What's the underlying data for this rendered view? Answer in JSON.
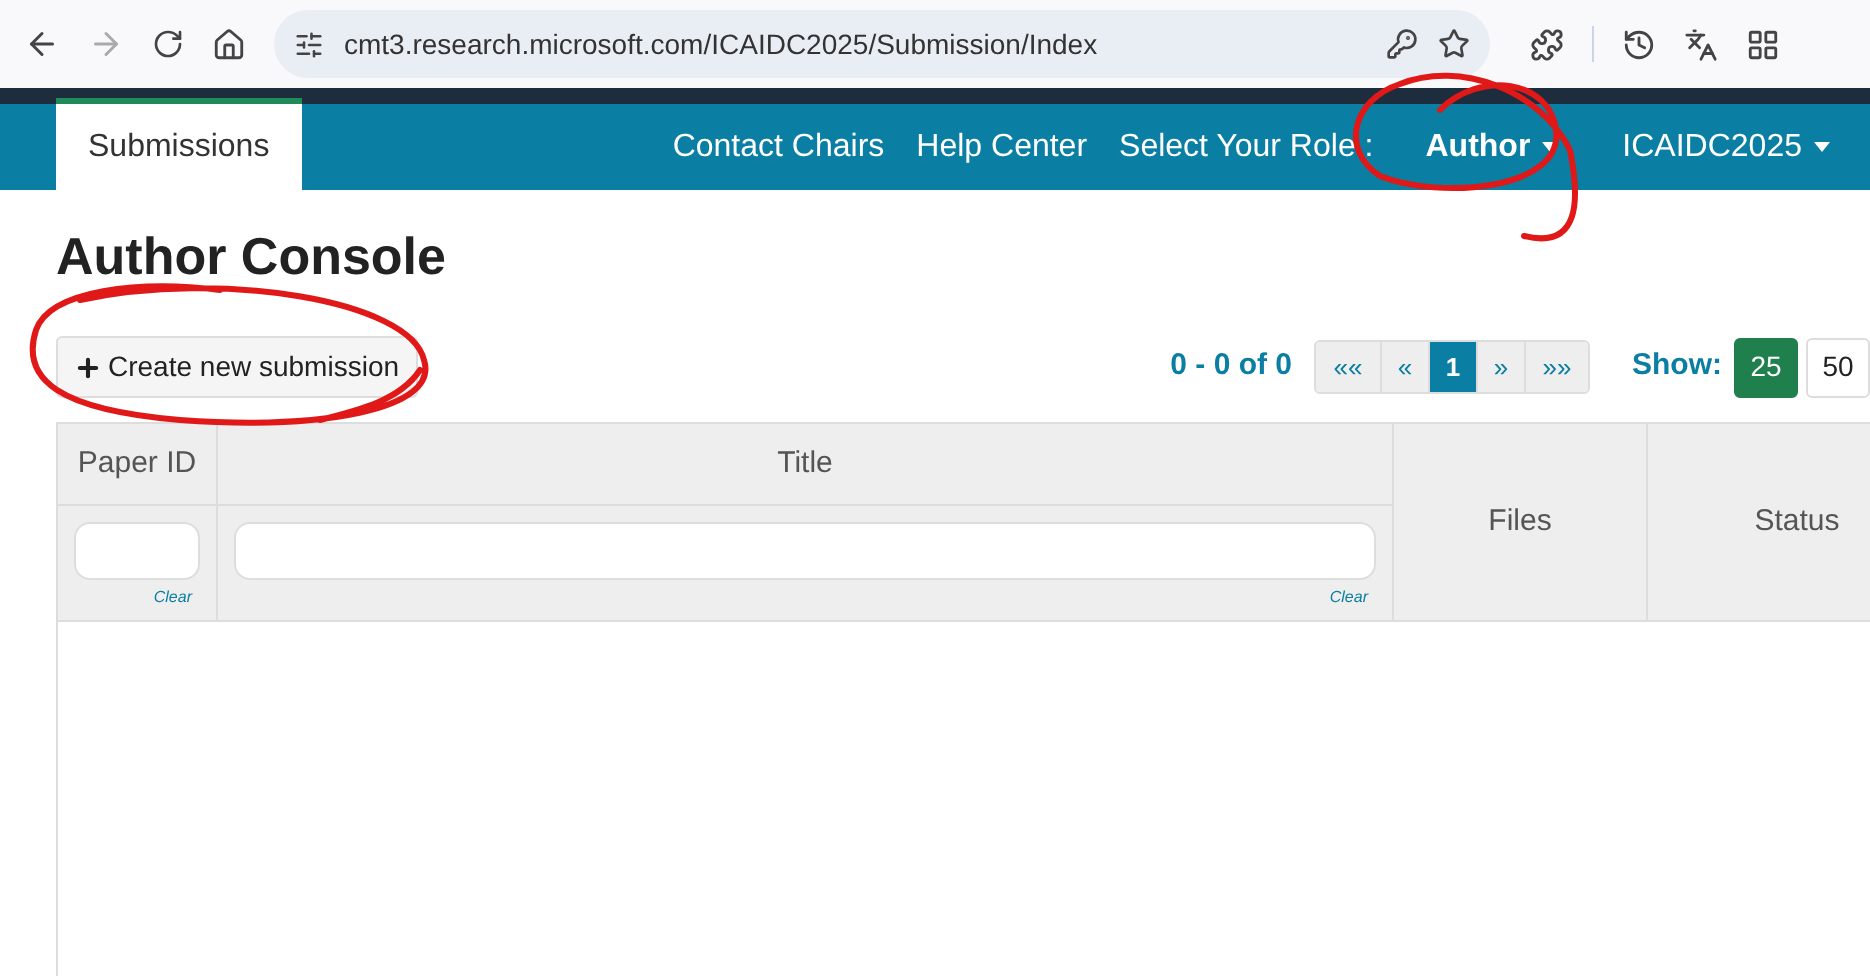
{
  "browser": {
    "url": "cmt3.research.microsoft.com/ICAIDC2025/Submission/Index"
  },
  "nav": {
    "tabs": [
      {
        "label": "Submissions",
        "selected": true
      }
    ],
    "links": [
      "Contact Chairs",
      "Help Center"
    ],
    "role_label": "Select Your Role :",
    "role": "Author",
    "conference": "ICAIDC2025"
  },
  "page_title": "Author Console",
  "create_button": "Create new submission",
  "pager": {
    "summary": "0 - 0 of 0",
    "buttons": [
      {
        "label": "««",
        "selected": false
      },
      {
        "label": "«",
        "selected": false
      },
      {
        "label": "1",
        "selected": true
      },
      {
        "label": "»",
        "selected": false
      },
      {
        "label": "»»",
        "selected": false
      }
    ]
  },
  "show": {
    "label": "Show:",
    "options": [
      {
        "label": "25",
        "selected": true
      },
      {
        "label": "50",
        "selected": false
      }
    ]
  },
  "table": {
    "columns": [
      {
        "label": "Paper ID",
        "filter": true,
        "clear": "Clear"
      },
      {
        "label": "Title",
        "filter": true,
        "clear": "Clear"
      },
      {
        "label": "Files",
        "filter": false
      },
      {
        "label": "Status",
        "filter": false
      }
    ]
  }
}
